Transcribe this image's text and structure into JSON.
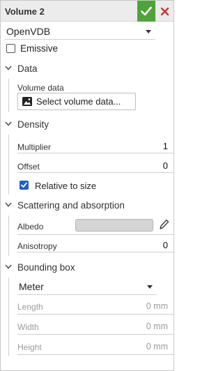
{
  "header": {
    "title": "Volume 2",
    "confirm_icon": "check-icon",
    "cancel_icon": "close-icon",
    "accent": "#4fa33b",
    "cancel_color": "#d2322d"
  },
  "renderer": {
    "selected": "OpenVDB"
  },
  "emissive": {
    "label": "Emissive",
    "checked": false
  },
  "data_section": {
    "title": "Data",
    "volume_data_label": "Volume data",
    "select_button": "Select volume data..."
  },
  "density_section": {
    "title": "Density",
    "multiplier_label": "Multiplier",
    "multiplier_value": "1",
    "offset_label": "Offset",
    "offset_value": "0",
    "relative_label": "Relative to size",
    "relative_checked": true
  },
  "scattering_section": {
    "title": "Scattering and absorption",
    "albedo_label": "Albedo",
    "albedo_color": "#d5d5d5",
    "anisotropy_label": "Anisotropy",
    "anisotropy_value": "0"
  },
  "bbox_section": {
    "title": "Bounding box",
    "unit": "Meter",
    "length_label": "Length",
    "length_value": "0 mm",
    "width_label": "Width",
    "width_value": "0 mm",
    "height_label": "Height",
    "height_value": "0 mm"
  }
}
